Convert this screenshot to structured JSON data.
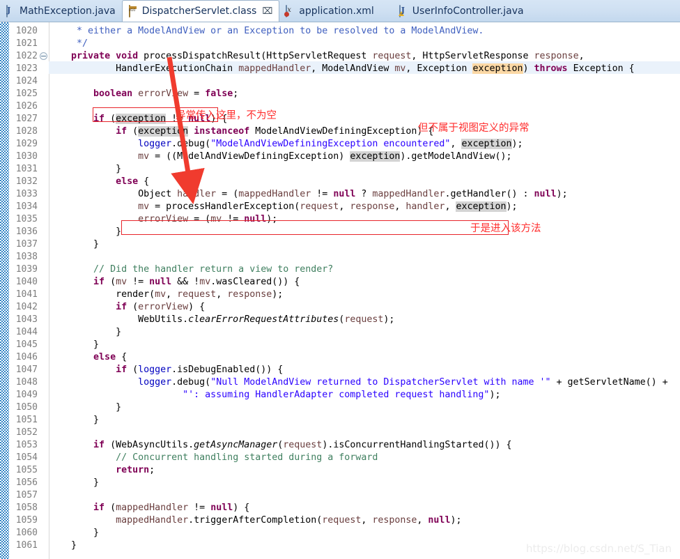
{
  "window": {
    "app": "Eclipse IDE — Java Editor",
    "watermark": "https://blog.csdn.net/S_Tian"
  },
  "tabs": [
    {
      "label": "MathException.java",
      "icon": "java-file-icon",
      "active": false,
      "closable": false
    },
    {
      "label": "DispatcherServlet.class",
      "icon": "class-file-icon",
      "active": true,
      "closable": true,
      "close_glyph": "⌧"
    },
    {
      "label": "application.xml",
      "icon": "xml-file-icon",
      "active": false,
      "closable": false
    },
    {
      "label": "UserInfoController.java",
      "icon": "java-warning-file-icon",
      "active": false,
      "closable": false
    }
  ],
  "editor": {
    "first_line_number": 1020,
    "highlighted_lines": [
      1023
    ],
    "folding_markers": [
      1022
    ],
    "lines": [
      {
        "n": 1020,
        "text": "     * either a ModelAndView or an Exception to be resolved to a ModelAndView."
      },
      {
        "n": 1021,
        "text": "     */"
      },
      {
        "n": 1022,
        "text": "    private void processDispatchResult(HttpServletRequest request, HttpServletResponse response,"
      },
      {
        "n": 1023,
        "text": "            HandlerExecutionChain mappedHandler, ModelAndView mv, Exception exception) throws Exception {"
      },
      {
        "n": 1024,
        "text": ""
      },
      {
        "n": 1025,
        "text": "        boolean errorView = false;"
      },
      {
        "n": 1026,
        "text": ""
      },
      {
        "n": 1027,
        "text": "        if (exception != null) {"
      },
      {
        "n": 1028,
        "text": "            if (exception instanceof ModelAndViewDefiningException) {"
      },
      {
        "n": 1029,
        "text": "                logger.debug(\"ModelAndViewDefiningException encountered\", exception);"
      },
      {
        "n": 1030,
        "text": "                mv = ((ModelAndViewDefiningException) exception).getModelAndView();"
      },
      {
        "n": 1031,
        "text": "            }"
      },
      {
        "n": 1032,
        "text": "            else {"
      },
      {
        "n": 1033,
        "text": "                Object handler = (mappedHandler != null ? mappedHandler.getHandler() : null);"
      },
      {
        "n": 1034,
        "text": "                mv = processHandlerException(request, response, handler, exception);"
      },
      {
        "n": 1035,
        "text": "                errorView = (mv != null);"
      },
      {
        "n": 1036,
        "text": "            }"
      },
      {
        "n": 1037,
        "text": "        }"
      },
      {
        "n": 1038,
        "text": ""
      },
      {
        "n": 1039,
        "text": "        // Did the handler return a view to render?"
      },
      {
        "n": 1040,
        "text": "        if (mv != null && !mv.wasCleared()) {"
      },
      {
        "n": 1041,
        "text": "            render(mv, request, response);"
      },
      {
        "n": 1042,
        "text": "            if (errorView) {"
      },
      {
        "n": 1043,
        "text": "                WebUtils.clearErrorRequestAttributes(request);"
      },
      {
        "n": 1044,
        "text": "            }"
      },
      {
        "n": 1045,
        "text": "        }"
      },
      {
        "n": 1046,
        "text": "        else {"
      },
      {
        "n": 1047,
        "text": "            if (logger.isDebugEnabled()) {"
      },
      {
        "n": 1048,
        "text": "                logger.debug(\"Null ModelAndView returned to DispatcherServlet with name '\" + getServletName() +"
      },
      {
        "n": 1049,
        "text": "                        \"': assuming HandlerAdapter completed request handling\");"
      },
      {
        "n": 1050,
        "text": "            }"
      },
      {
        "n": 1051,
        "text": "        }"
      },
      {
        "n": 1052,
        "text": ""
      },
      {
        "n": 1053,
        "text": "        if (WebAsyncUtils.getAsyncManager(request).isConcurrentHandlingStarted()) {"
      },
      {
        "n": 1054,
        "text": "            // Concurrent handling started during a forward"
      },
      {
        "n": 1055,
        "text": "            return;"
      },
      {
        "n": 1056,
        "text": "        }"
      },
      {
        "n": 1057,
        "text": ""
      },
      {
        "n": 1058,
        "text": "        if (mappedHandler != null) {"
      },
      {
        "n": 1059,
        "text": "            mappedHandler.triggerAfterCompletion(request, response, null);"
      },
      {
        "n": 1060,
        "text": "        }"
      },
      {
        "n": 1061,
        "text": "    }"
      }
    ]
  },
  "annotations": {
    "notes": [
      {
        "id": "note-exception-not-null",
        "text": "异常传入这里，不为空",
        "line": 1027
      },
      {
        "id": "note-not-view-defining",
        "text": "但不属于视图定义的异常",
        "line": 1028
      },
      {
        "id": "note-enter-method",
        "text": "于是进入该方法",
        "line": 1034
      }
    ],
    "boxes": [
      {
        "id": "box-if-exception-null",
        "line": 1027
      },
      {
        "id": "box-process-handler-exception",
        "line": 1034
      }
    ],
    "arrow": {
      "id": "red-arrow",
      "from_line": 1022,
      "to_line": 1034,
      "color": "#f03b2e"
    },
    "colors": {
      "annotation_red": "#ff2d2d",
      "box_red": "#e8242a",
      "arrow_red": "#f03b2e"
    }
  },
  "theme": {
    "keyword": "#7f0055",
    "string": "#2a00ff",
    "comment": "#3f7f5f",
    "javadoc": "#3f5fbf",
    "parameter": "#6a3e3e",
    "field": "#0000c0",
    "occurrence_highlight": "#d4d4d4",
    "write_occurrence_highlight": "#fbd8a5",
    "current_line": "#eaf2fb",
    "line_number": "#7d7d7d"
  }
}
